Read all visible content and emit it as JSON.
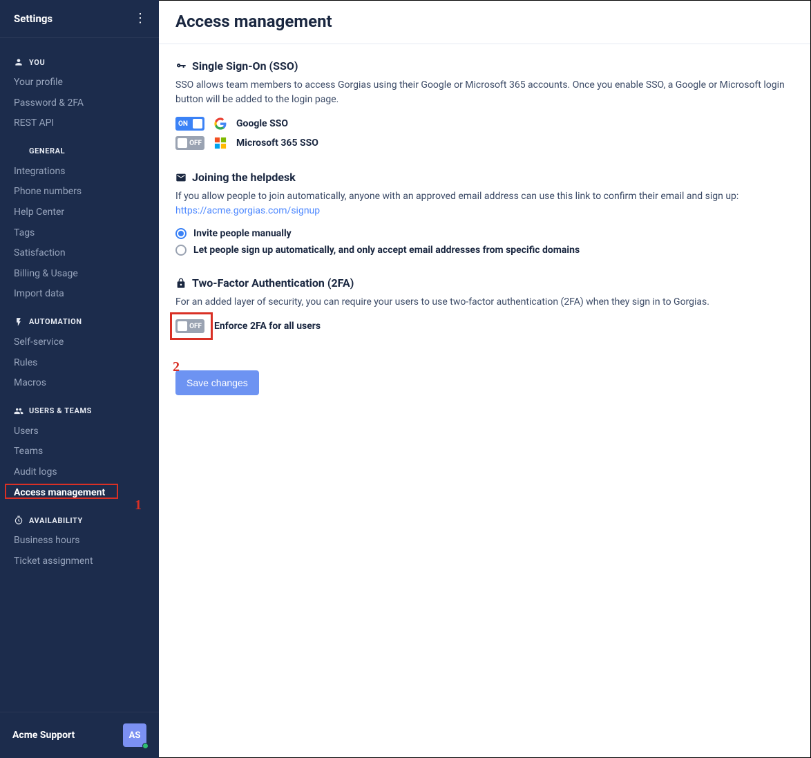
{
  "sidebar": {
    "title": "Settings",
    "sections": {
      "you": {
        "label": "YOU",
        "items": [
          "Your profile",
          "Password & 2FA",
          "REST API"
        ]
      },
      "general": {
        "label": "GENERAL",
        "items": [
          "Integrations",
          "Phone numbers",
          "Help Center",
          "Tags",
          "Satisfaction",
          "Billing & Usage",
          "Import data"
        ]
      },
      "automation": {
        "label": "AUTOMATION",
        "items": [
          "Self-service",
          "Rules",
          "Macros"
        ]
      },
      "users_teams": {
        "label": "USERS & TEAMS",
        "items": [
          "Users",
          "Teams",
          "Audit logs",
          "Access management"
        ]
      },
      "availability": {
        "label": "AVAILABILITY",
        "items": [
          "Business hours",
          "Ticket assignment"
        ]
      }
    },
    "footer": {
      "org": "Acme Support",
      "avatar_initials": "AS"
    }
  },
  "page": {
    "title": "Access management",
    "sso": {
      "heading": "Single Sign-On (SSO)",
      "desc": "SSO allows team members to access Gorgias using their Google or Microsoft 365 accounts. Once you enable SSO, a Google or Microsoft login button will be added to the login page.",
      "google": {
        "state": "ON",
        "label": "Google SSO"
      },
      "microsoft": {
        "state": "OFF",
        "label": "Microsoft 365 SSO"
      }
    },
    "joining": {
      "heading": "Joining the helpdesk",
      "desc_pre": "If you allow people to join automatically, anyone with an approved email address can use this link to confirm their email and sign up: ",
      "link": "https://acme.gorgias.com/signup",
      "option_manual": "Invite people manually",
      "option_auto": "Let people sign up automatically, and only accept email addresses from specific domains"
    },
    "twofa": {
      "heading": "Two-Factor Authentication (2FA)",
      "desc": "For an added layer of security, you can require your users to use two-factor authentication (2FA) when they sign in to Gorgias.",
      "toggle_state": "OFF",
      "toggle_label": "Enforce 2FA for all users"
    },
    "save_label": "Save changes"
  },
  "annotations": {
    "label1": "1",
    "label2": "2"
  }
}
